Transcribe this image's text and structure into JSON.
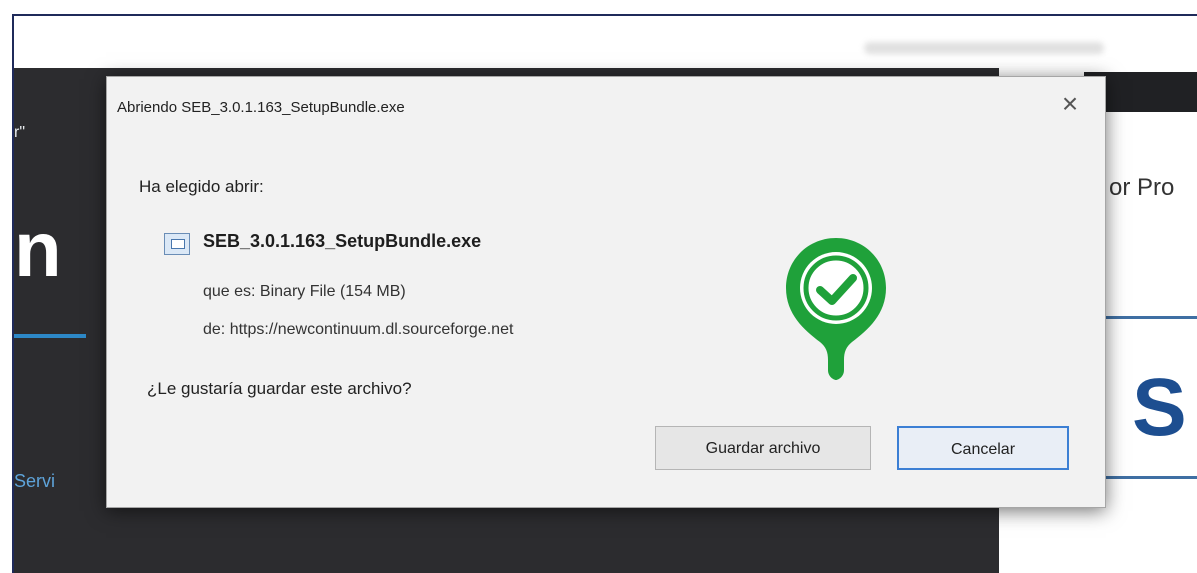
{
  "dialog": {
    "title": "Abriendo SEB_3.0.1.163_SetupBundle.exe",
    "close_glyph": "×",
    "prompt": "Ha elegido abrir:",
    "file_name": "SEB_3.0.1.163_SetupBundle.exe",
    "file_type_line": "que es: Binary File (154 MB)",
    "file_from_line": "de: https://newcontinuum.dl.sourceforge.net",
    "question": "¿Le gustaría guardar este archivo?",
    "save_label": "Guardar archivo",
    "cancel_label": "Cancelar"
  },
  "background": {
    "left_small_text": "r\"",
    "left_big_text": "n E",
    "left_link_text": "Servi",
    "right_text": "or Pro",
    "right_big_text": "S"
  },
  "icons": {
    "file_icon": "file-icon",
    "check_badge": "check-pin-icon"
  },
  "colors": {
    "check_badge": "#1fa13a",
    "button_focus": "#3c7fd4"
  }
}
